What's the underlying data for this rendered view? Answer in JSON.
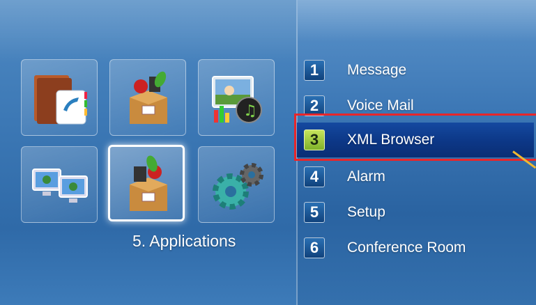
{
  "left_panel": {
    "section_label": "5. Applications",
    "tiles": [
      {
        "icon": "phonebook-icon"
      },
      {
        "icon": "apps-box-icon"
      },
      {
        "icon": "media-icon"
      },
      {
        "icon": "network-computers-icon"
      },
      {
        "icon": "apps-box-selected-icon",
        "selected": true
      },
      {
        "icon": "settings-gears-icon"
      }
    ]
  },
  "menu": {
    "items": [
      {
        "number": "1",
        "label": "Message"
      },
      {
        "number": "2",
        "label": "Voice Mail"
      },
      {
        "number": "3",
        "label": "XML Browser",
        "active": true
      },
      {
        "number": "4",
        "label": "Alarm"
      },
      {
        "number": "5",
        "label": "Setup"
      },
      {
        "number": "6",
        "label": "Conference Room"
      }
    ]
  },
  "colors": {
    "highlight": "#0c3786",
    "active_number": "#a6d040",
    "annotation_outline": "#e8262a",
    "annotation_line": "#f0b830"
  }
}
